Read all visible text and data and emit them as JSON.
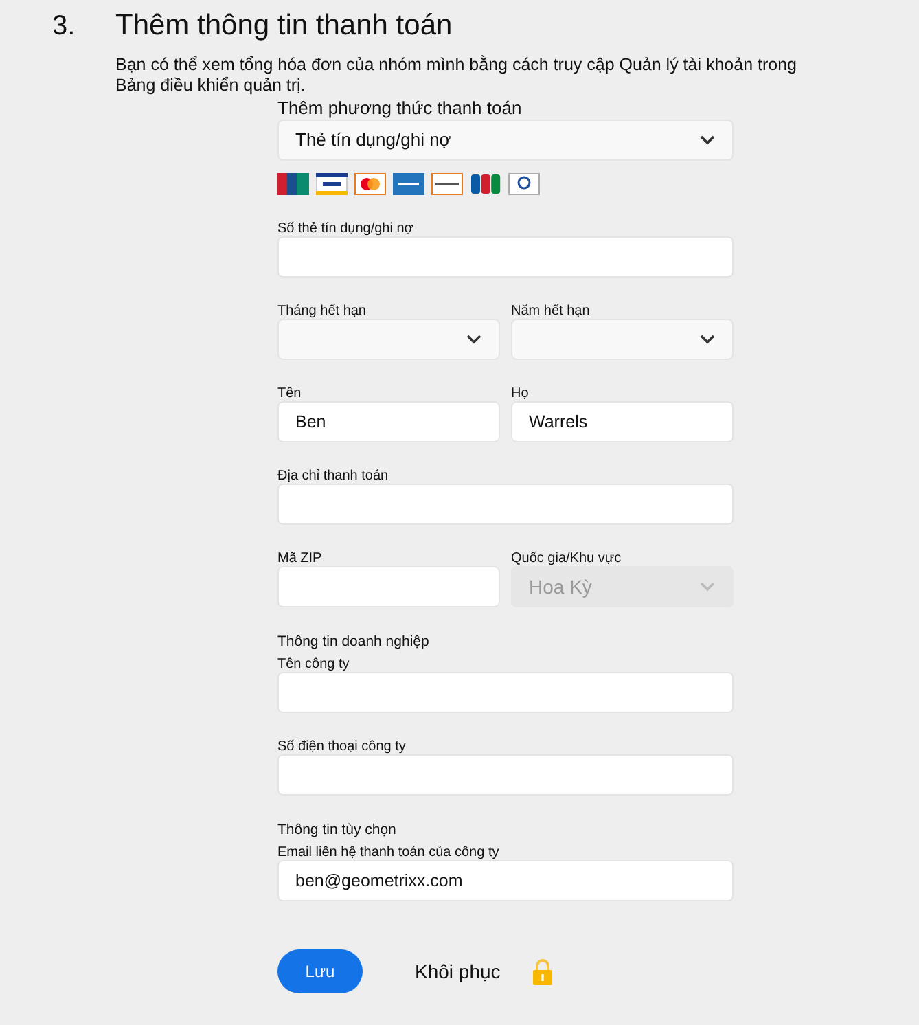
{
  "step": {
    "number": "3.",
    "title": "Thêm thông tin thanh toán",
    "description": "Bạn có thể xem tổng hóa đơn của nhóm mình bằng cách truy cập Quản lý tài khoản trong Bảng điều khiển quản trị."
  },
  "method": {
    "label": "Thêm phương thức thanh toán",
    "value": "Thẻ tín dụng/ghi nợ"
  },
  "items": [
    {
      "kind": "row",
      "fields": [
        {
          "label": "Số thẻ tín dụng/ghi nợ",
          "kind": "input"
        }
      ]
    },
    {
      "kind": "row",
      "fields": [
        {
          "label": "Tháng hết hạn",
          "kind": "select"
        },
        {
          "label": "Năm hết hạn",
          "kind": "select"
        }
      ]
    },
    {
      "kind": "row",
      "fields": [
        {
          "label": "Tên",
          "kind": "input",
          "value": "Ben"
        },
        {
          "label": "Họ",
          "kind": "input",
          "value": "Warrels"
        }
      ]
    },
    {
      "kind": "row",
      "fields": [
        {
          "label": "Địa chỉ thanh toán",
          "kind": "input"
        }
      ]
    },
    {
      "kind": "row",
      "fields": [
        {
          "label": "Mã ZIP",
          "kind": "input"
        },
        {
          "label": "Quốc gia/Khu vực",
          "kind": "select",
          "value": "Hoa Kỳ",
          "disabled": true
        }
      ]
    },
    {
      "kind": "heading",
      "text": "Thông tin doanh nghiệp"
    },
    {
      "kind": "row",
      "fields": [
        {
          "label": "Tên công ty",
          "kind": "input"
        }
      ]
    },
    {
      "kind": "row",
      "fields": [
        {
          "label": "Số điện thoại công ty",
          "kind": "input"
        }
      ]
    },
    {
      "kind": "heading",
      "text": "Thông tin tùy chọn"
    },
    {
      "kind": "row",
      "fields": [
        {
          "label": "Email liên hệ thanh toán của công ty",
          "kind": "input",
          "value": "ben@geometrixx.com"
        }
      ]
    }
  ],
  "actions": {
    "save": "Lưu",
    "reset": "Khôi phục"
  }
}
